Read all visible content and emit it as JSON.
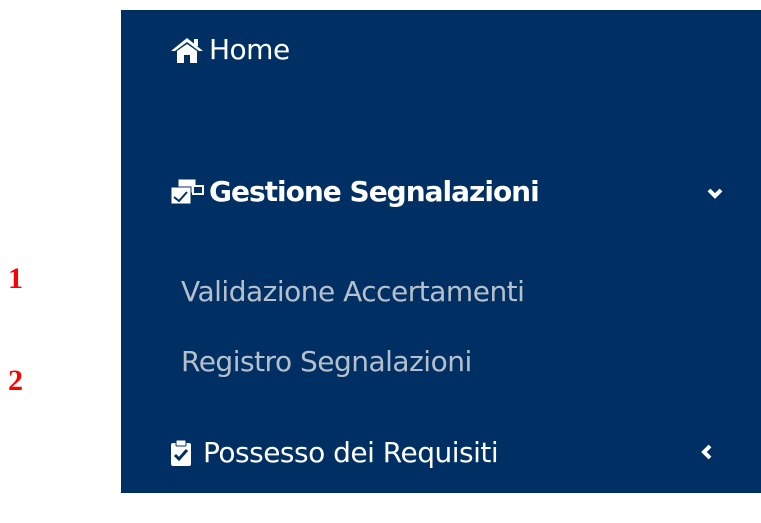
{
  "callouts": [
    "1",
    "2"
  ],
  "callout_color": "#ff0000",
  "sidebar": {
    "bg": "#003063",
    "home": {
      "label": "Home",
      "icon": "home-icon"
    },
    "gestione": {
      "label": "Gestione Segnalazioni",
      "icon": "documents-icon",
      "toggle_icon": "chevron-down-icon",
      "expanded": true,
      "children": [
        {
          "label": "Validazione Accertamenti"
        },
        {
          "label": "Registro Segnalazioni"
        }
      ]
    },
    "possesso": {
      "label": "Possesso dei Requisiti",
      "icon": "clipboard-check-icon",
      "toggle_icon": "chevron-left-icon",
      "expanded": false
    }
  }
}
